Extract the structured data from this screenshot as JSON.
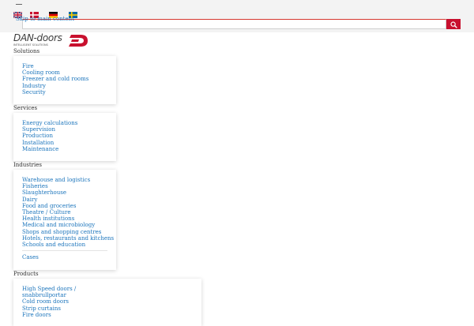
{
  "header": {
    "skip_link": "Skip to main content",
    "search": {
      "value": "",
      "placeholder": ""
    },
    "languages": [
      "English",
      "Danish",
      "German",
      "Swedish"
    ],
    "logo": {
      "name": "DAN-doors",
      "tagline": "INTELLIGENT SOLUTIONS"
    },
    "colors": {
      "brand_red": "#c8102e",
      "link_blue": "#1c75bc"
    }
  },
  "nav": {
    "solutions": {
      "heading": "Solutions",
      "items": [
        "Fire",
        "Cooling room",
        "Freezer and cold rooms",
        "Industry",
        "Security"
      ]
    },
    "services": {
      "heading": "Services",
      "items": [
        "Energy calculations",
        "Supervision",
        "Production",
        "Installation",
        "Maintenance"
      ]
    },
    "industries": {
      "heading": "Industries",
      "items": [
        "Warehouse and logistics",
        "Fisheries",
        "Slaughterhouse",
        "Dairy",
        "Food and groceries",
        "Theatre / Culture",
        "Health institutions",
        "Medical and microbiology",
        "Shops and shopping centres",
        "Hotels, restaurants and kitchens",
        "Schools and education"
      ],
      "extra": "Cases"
    },
    "products": {
      "heading": "Products",
      "items": [
        "High Speed doors /",
        "snabbrullportar",
        "Cold room doors",
        "Strip curtains",
        "Fire doors"
      ]
    }
  }
}
